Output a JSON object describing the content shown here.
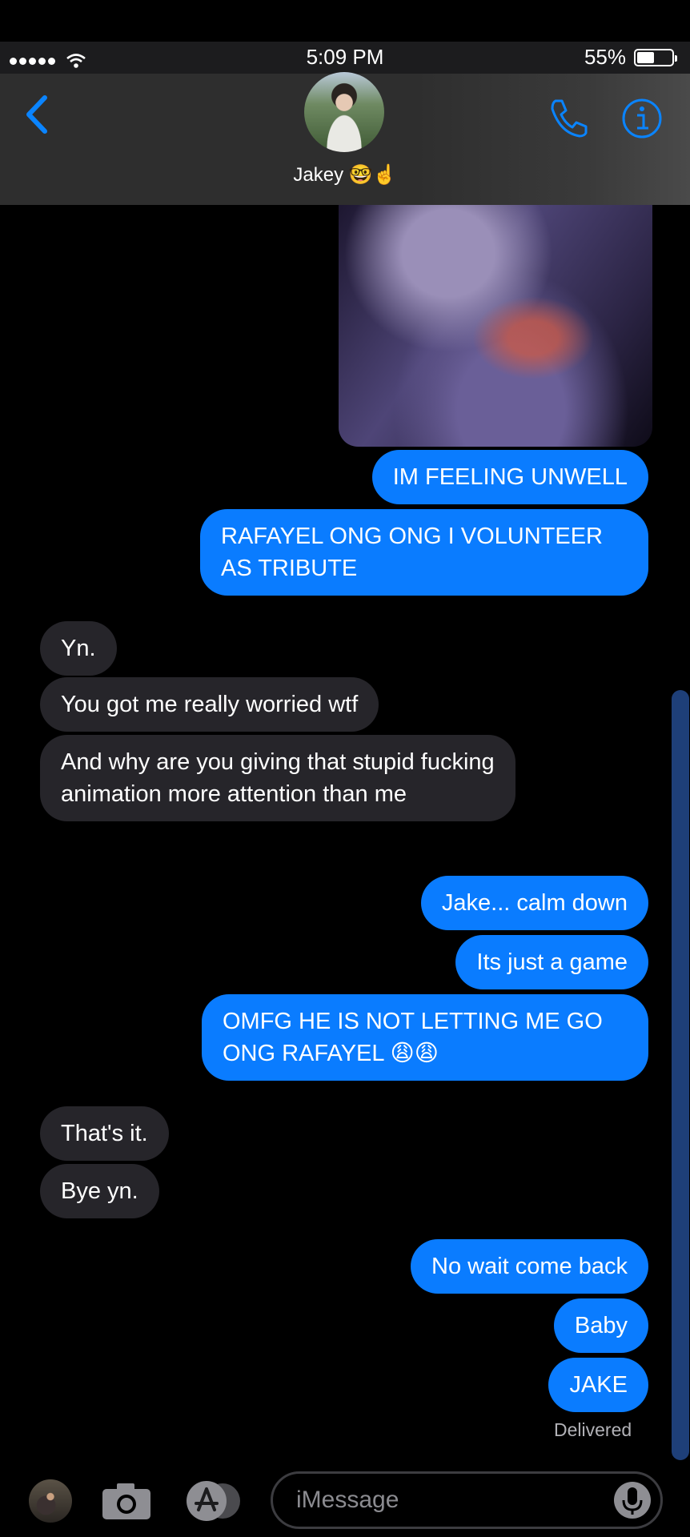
{
  "status_bar": {
    "time": "5:09 PM",
    "battery_text": "55%",
    "battery_level": 0.55
  },
  "header": {
    "contact_name": "Jakey 🤓☝️",
    "back_icon": "chevron-left-icon",
    "call_icon": "phone-icon",
    "info_icon": "info-icon"
  },
  "colors": {
    "sent_bubble": "#0a7cff",
    "received_bubble": "#26252a",
    "accent": "#0a84ff",
    "background": "#000000"
  },
  "messages": [
    {
      "side": "sent",
      "text": "IM FEELING UNWELL"
    },
    {
      "side": "sent",
      "text": "RAFAYEL ONG ONG I VOLUNTEER AS TRIBUTE"
    },
    {
      "side": "received",
      "text": "Yn."
    },
    {
      "side": "received",
      "text": "You got me really worried wtf"
    },
    {
      "side": "received",
      "text": "And why are you giving that stupid fucking animation more attention than me"
    },
    {
      "side": "sent",
      "text": "Jake... calm down"
    },
    {
      "side": "sent",
      "text": "Its just a game"
    },
    {
      "side": "sent",
      "text": "OMFG HE IS NOT LETTING ME GO ONG RAFAYEL 😩😩"
    },
    {
      "side": "received",
      "text": "That's it."
    },
    {
      "side": "received",
      "text": "Bye yn."
    },
    {
      "side": "sent",
      "text": "No wait come back"
    },
    {
      "side": "sent",
      "text": "Baby"
    },
    {
      "side": "sent",
      "text": "JAKE"
    }
  ],
  "delivered_label": "Delivered",
  "input": {
    "placeholder": "iMessage",
    "camera_icon": "camera-icon",
    "apps_icon": "app-store-icon",
    "mic_icon": "microphone-icon"
  }
}
